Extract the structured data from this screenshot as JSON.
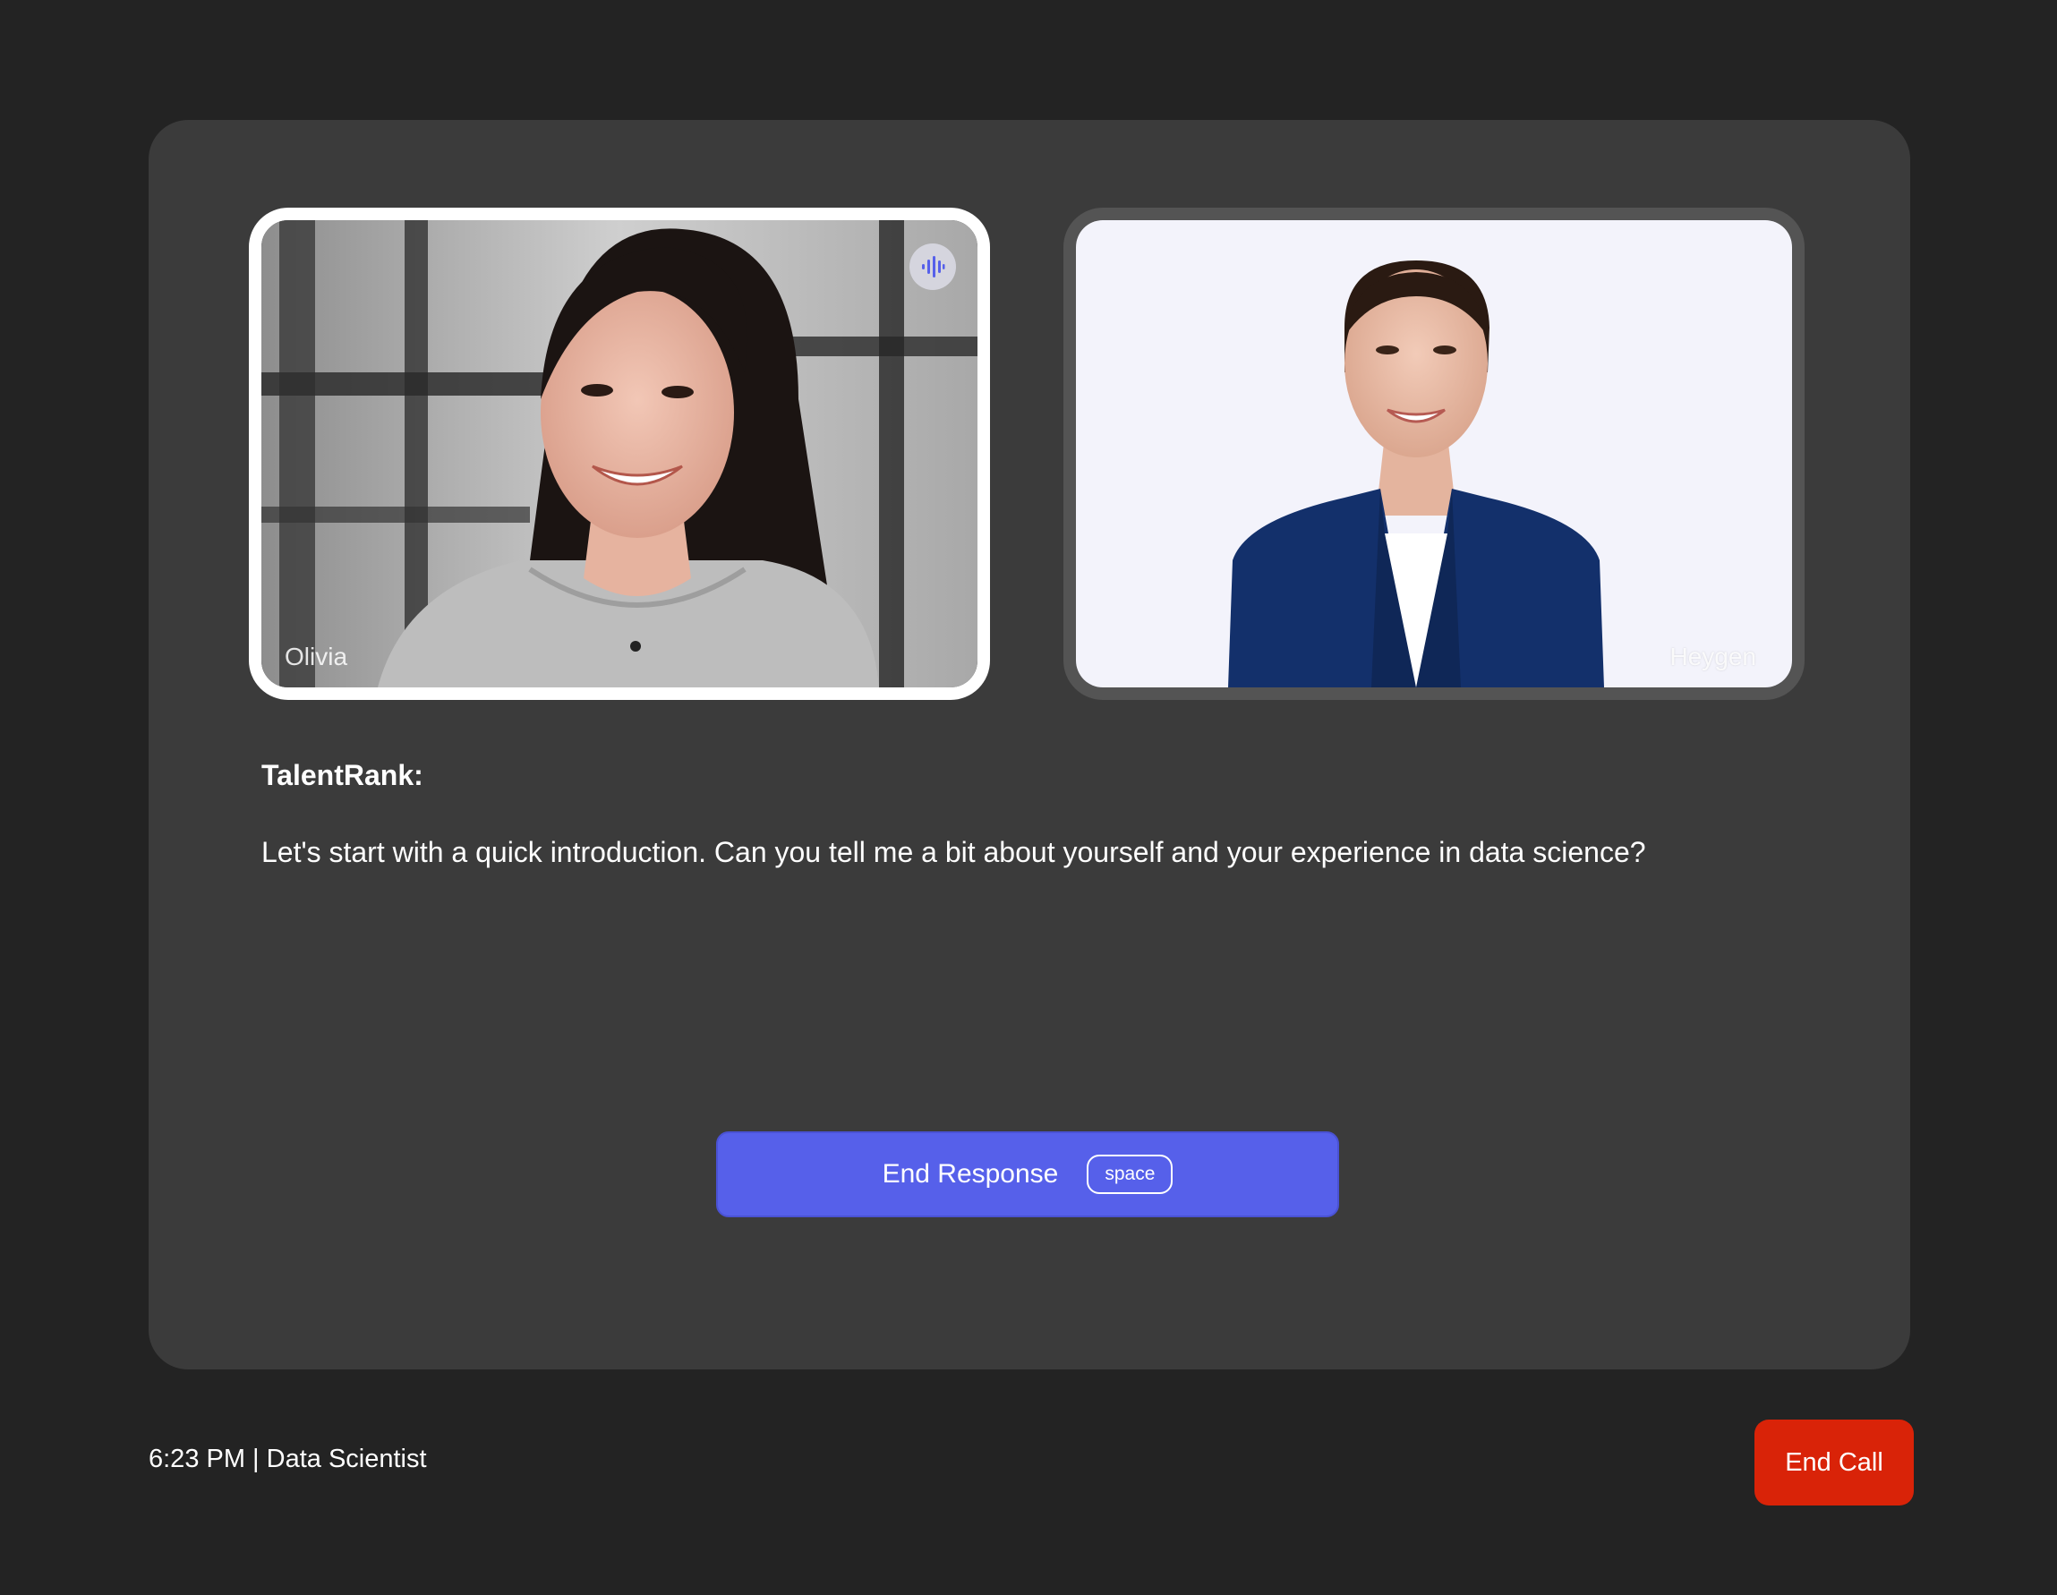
{
  "participants": {
    "user": {
      "name": "Olivia",
      "speaking_icon": "audio-waveform-icon"
    },
    "avatar": {
      "name": "Heygen"
    }
  },
  "transcript": {
    "speaker": "TalentRank:",
    "message": "Let's start with a quick introduction. Can you tell me a bit about yourself and your experience in data science?"
  },
  "controls": {
    "end_response_label": "End Response",
    "end_response_shortcut": "space",
    "end_call_label": "End Call"
  },
  "footer": {
    "info": "6:23 PM | Data Scientist"
  },
  "colors": {
    "page_bg": "#232323",
    "panel_bg": "#3b3b3b",
    "accent": "#5660ea",
    "danger": "#d92308",
    "active_tile_border": "#ffffff",
    "inactive_tile_border": "#545454"
  }
}
